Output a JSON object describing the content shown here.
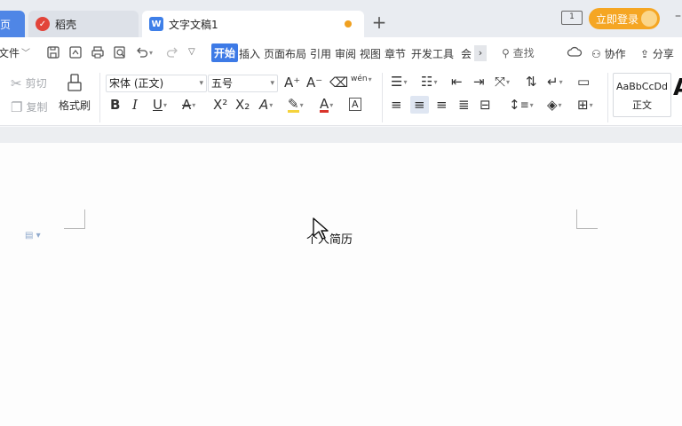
{
  "tabs": {
    "home_label": "页",
    "daoke_label": "稻壳",
    "doc_label": "文字文稿1",
    "new_tab": "+"
  },
  "window": {
    "layout_label": "1",
    "login_label": "立即登录",
    "minimize": "–"
  },
  "menubar": {
    "file_label": "文件",
    "items": [
      "开始",
      "插入",
      "页面布局",
      "引用",
      "审阅",
      "视图",
      "章节",
      "开发工具",
      "会"
    ],
    "more": "›",
    "search_label": "查找",
    "collab_label": "协作",
    "share_label": "分享"
  },
  "ribbon": {
    "cut_label": "剪切",
    "copy_label": "复制",
    "format_painter_label": "格式刷",
    "font_name": "宋体 (正文)",
    "font_size": "五号",
    "bold": "B",
    "italic": "I",
    "underline": "U",
    "strikethrough": "A",
    "superscript": "X²",
    "subscript": "X₂",
    "text_effect": "A",
    "font_color": "A",
    "char_border": "A",
    "grow_font": "A⁺",
    "shrink_font": "A⁻",
    "phonetic": "wén",
    "style_sample": "AaBbCcDd",
    "style_name": "正文",
    "style_next": "A",
    "highlight_color": "#f5d33c",
    "font_color_value": "#d9342b"
  },
  "document": {
    "title_text": "个人简历"
  },
  "colors": {
    "accent": "#3d7ae6",
    "login": "#f5a623",
    "unsaved": "#f0a020"
  }
}
